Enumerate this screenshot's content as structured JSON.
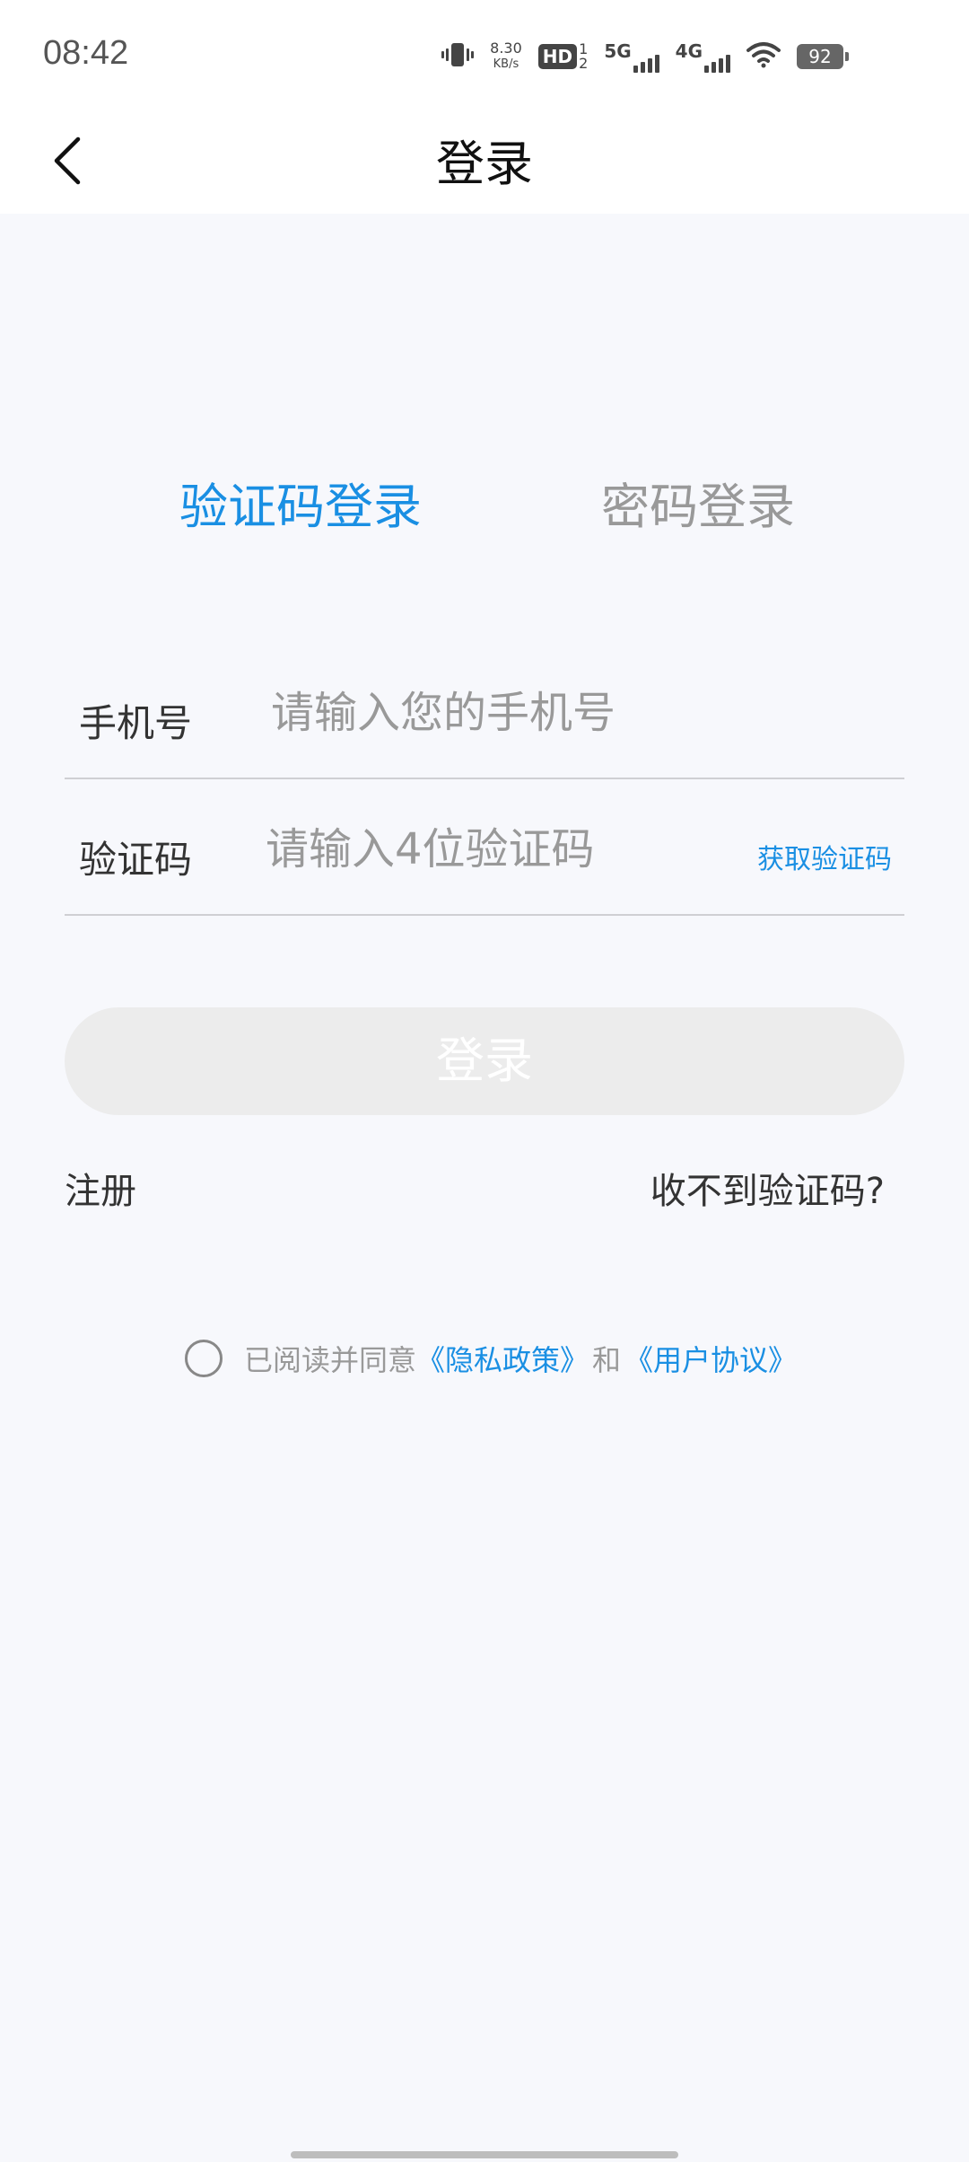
{
  "status_bar": {
    "time": "08:42",
    "net_speed_value": "8.30",
    "net_speed_unit": "KB/s",
    "hd_badge": "HD",
    "sim1": "1",
    "sim2": "2",
    "net_5g": "5G",
    "net_4g": "4G",
    "battery": "92",
    "icons": [
      "vibrate-icon",
      "hd-icon",
      "signal-icon",
      "signal-icon",
      "wifi-icon",
      "battery-icon"
    ]
  },
  "header": {
    "title": "登录",
    "back_icon": "chevron-left-icon"
  },
  "tabs": {
    "sms": "验证码登录",
    "password": "密码登录",
    "active": "sms"
  },
  "form": {
    "phone_label": "手机号",
    "phone_placeholder": "请输入您的手机号",
    "code_label": "验证码",
    "code_placeholder": "请输入4位验证码",
    "get_code": "获取验证码"
  },
  "login_button": "登录",
  "links": {
    "register": "注册",
    "no_code": "收不到验证码?"
  },
  "agreement": {
    "prefix": "已阅读并同意",
    "privacy": "《隐私政策》",
    "and": "和",
    "user_agreement": "《用户协议》",
    "checked": false
  },
  "colors": {
    "accent": "#1a8fe3",
    "muted": "#999999",
    "background": "#f7f8fc",
    "button_disabled": "#ececec"
  }
}
